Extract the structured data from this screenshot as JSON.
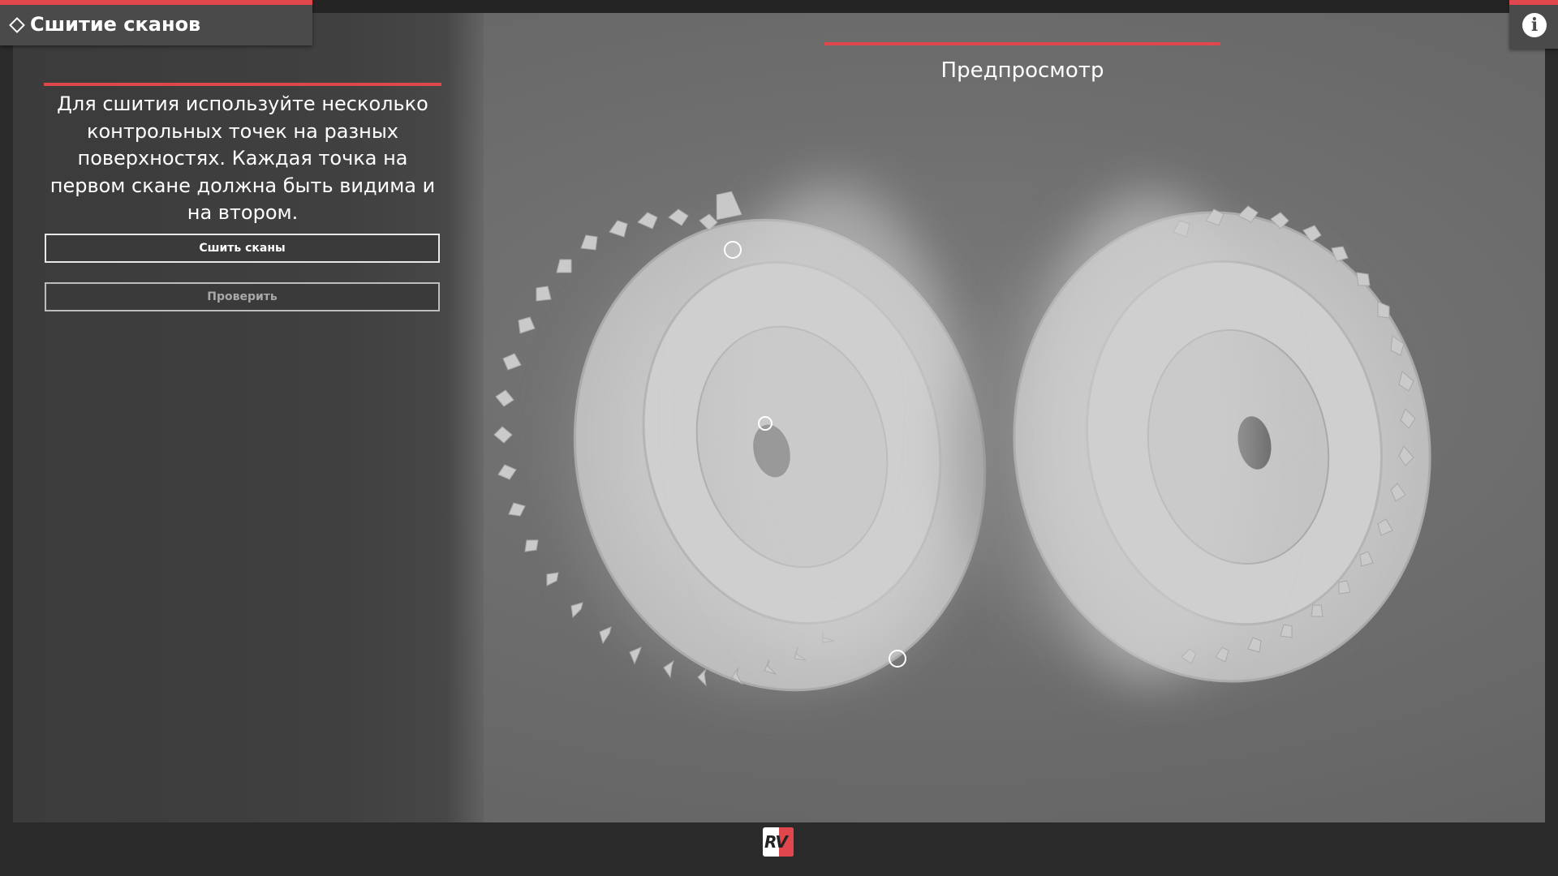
{
  "panel": {
    "title": "Сшитие сканов",
    "instructions": "Для сшития используйте несколько контрольных точек на разных поверхностях. Каждая точка на первом скане должна быть видима и на втором.",
    "stitch_button": "Сшить сканы",
    "verify_button": "Проверить"
  },
  "preview": {
    "label": "Предпросмотр"
  },
  "icons": {
    "info": "info-icon",
    "logo": "rv-logo"
  },
  "logo_text": "RV",
  "colors": {
    "accent": "#e0474c",
    "panel": "#404040",
    "viewport": "#707070"
  }
}
